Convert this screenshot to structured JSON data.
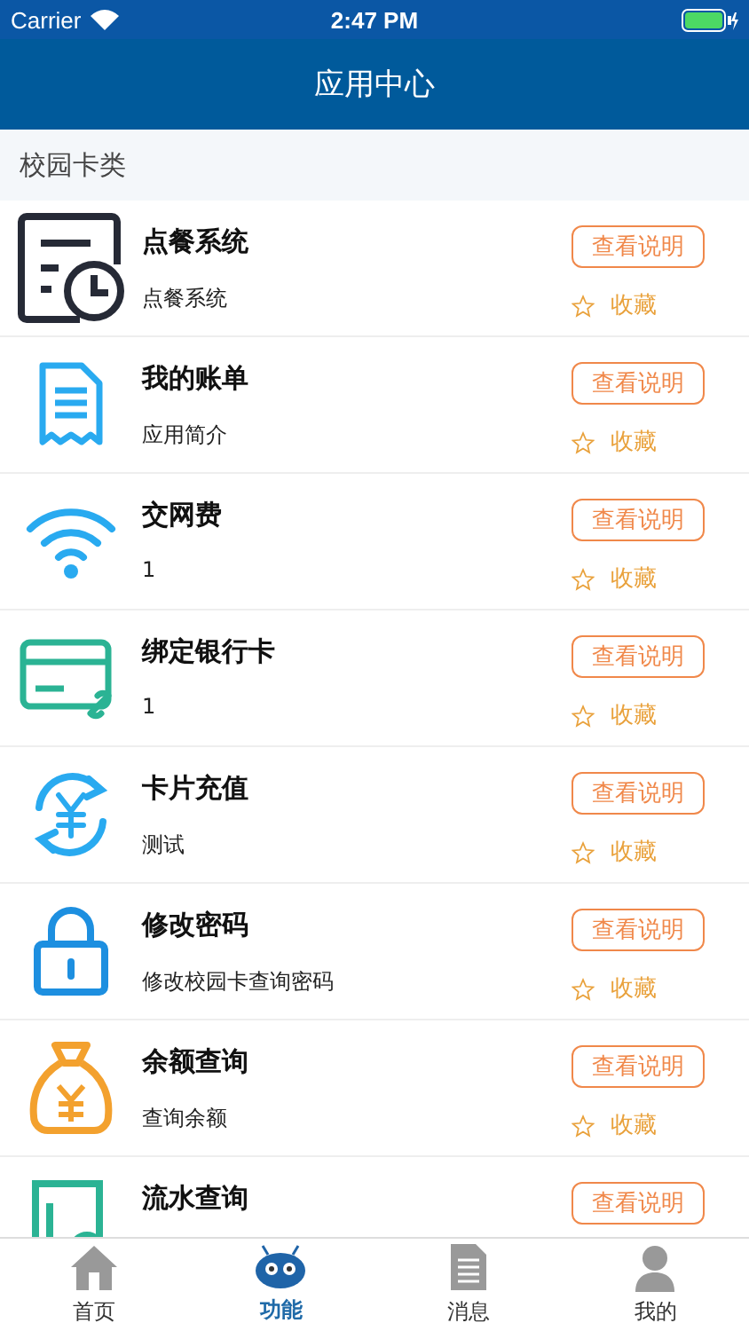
{
  "status_bar": {
    "carrier": "Carrier",
    "time": "2:47 PM"
  },
  "nav": {
    "title": "应用中心"
  },
  "section": {
    "title": "校园卡类"
  },
  "apps": [
    {
      "title": "点餐系统",
      "subtitle": "点餐系统",
      "button": "查看说明",
      "favorite_label": "收藏",
      "favorited": false
    },
    {
      "title": "我的账单",
      "subtitle": "应用简介",
      "button": "查看说明",
      "favorite_label": "收藏",
      "favorited": false
    },
    {
      "title": "交网费",
      "subtitle": "1",
      "button": "查看说明",
      "favorite_label": "收藏",
      "favorited": false
    },
    {
      "title": "绑定银行卡",
      "subtitle": "1",
      "button": "查看说明",
      "favorite_label": "收藏",
      "favorited": false
    },
    {
      "title": "卡片充值",
      "subtitle": "测试",
      "button": "查看说明",
      "favorite_label": "收藏",
      "favorited": false
    },
    {
      "title": "修改密码",
      "subtitle": "修改校园卡查询密码",
      "button": "查看说明",
      "favorite_label": "收藏",
      "favorited": false
    },
    {
      "title": "余额查询",
      "subtitle": "查询余额",
      "button": "查看说明",
      "favorite_label": "收藏",
      "favorited": false
    },
    {
      "title": "流水查询",
      "button": "查看说明"
    }
  ],
  "tabs": [
    {
      "label": "首页",
      "selected": false
    },
    {
      "label": "功能",
      "selected": true
    },
    {
      "label": "消息",
      "selected": false
    },
    {
      "label": "我的",
      "selected": false
    }
  ]
}
